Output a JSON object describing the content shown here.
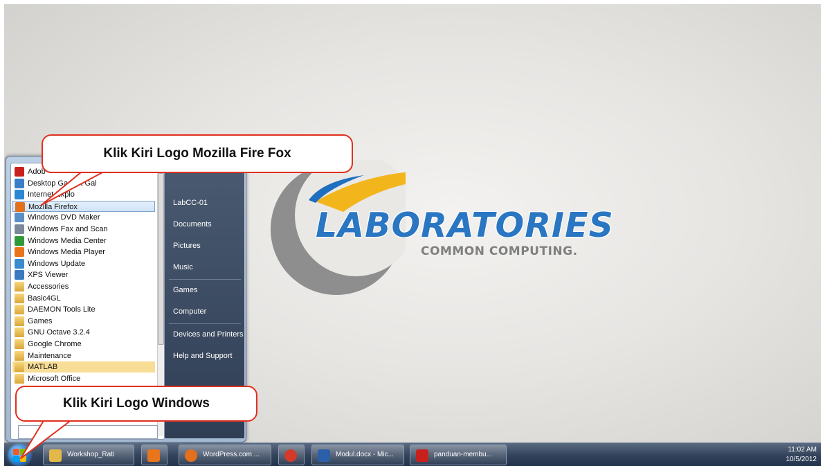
{
  "logo": {
    "brand": "LABORATORIES",
    "tagline": "COMMON COMPUTING."
  },
  "start_menu": {
    "programs": [
      {
        "label": "Adob",
        "icon": "adobe-reader-icon",
        "color": "#c8201c"
      },
      {
        "label": "Desktop Gadget Gal",
        "icon": "gadget-icon",
        "color": "#3b7ec8"
      },
      {
        "label": "Internet Explo",
        "icon": "internet-explorer-icon",
        "color": "#2b87d3"
      },
      {
        "label": "Mozilla Firefox",
        "icon": "firefox-icon",
        "color": "#e2701c"
      },
      {
        "label": "Windows DVD Maker",
        "icon": "dvd-maker-icon",
        "color": "#5a8fc8"
      },
      {
        "label": "Windows Fax and Scan",
        "icon": "fax-scan-icon",
        "color": "#7a8a9a"
      },
      {
        "label": "Windows Media Center",
        "icon": "media-center-icon",
        "color": "#2f9a3a"
      },
      {
        "label": "Windows Media Player",
        "icon": "media-player-icon",
        "color": "#e8741c"
      },
      {
        "label": "Windows Update",
        "icon": "windows-update-icon",
        "color": "#3a8ad0"
      },
      {
        "label": "XPS Viewer",
        "icon": "xps-viewer-icon",
        "color": "#3a7ac0"
      },
      {
        "label": "Accessories",
        "icon": "folder-icon",
        "color": "#e3b84a"
      },
      {
        "label": "Basic4GL",
        "icon": "folder-icon",
        "color": "#e3b84a"
      },
      {
        "label": "DAEMON Tools Lite",
        "icon": "folder-icon",
        "color": "#e3b84a"
      },
      {
        "label": "Games",
        "icon": "folder-icon",
        "color": "#e3b84a"
      },
      {
        "label": "GNU Octave 3.2.4",
        "icon": "folder-icon",
        "color": "#e3b84a"
      },
      {
        "label": "Google Chrome",
        "icon": "folder-icon",
        "color": "#e3b84a"
      },
      {
        "label": "Maintenance",
        "icon": "folder-icon",
        "color": "#e3b84a"
      },
      {
        "label": "MATLAB",
        "icon": "folder-icon",
        "color": "#e3b84a"
      },
      {
        "label": "Microsoft Office",
        "icon": "folder-icon",
        "color": "#e3b84a"
      }
    ],
    "places": [
      "LabCC-01",
      "Documents",
      "Pictures",
      "Music",
      "Games",
      "Computer",
      "Devices and Printers",
      "Help and Support"
    ]
  },
  "taskbar": {
    "buttons": [
      {
        "label": "Workshop_Rati",
        "icon": "folder-icon",
        "color": "#e3b84a"
      },
      {
        "label": "",
        "icon": "media-player-icon",
        "color": "#e8741c"
      },
      {
        "label": "WordPress.com ...",
        "icon": "firefox-icon",
        "color": "#e2701c"
      },
      {
        "label": "",
        "icon": "chrome-icon",
        "color": "#d43a2a"
      },
      {
        "label": "Modul.docx - Mic...",
        "icon": "word-icon",
        "color": "#2b5fa8"
      },
      {
        "label": "panduan-membu...",
        "icon": "pdf-icon",
        "color": "#c8201c"
      }
    ],
    "time": "11:02 AM",
    "date": "10/5/2012"
  },
  "callouts": {
    "firefox": "Klik Kiri Logo Mozilla Fire Fox",
    "windows": "Klik Kiri Logo Windows"
  },
  "colors": {
    "accent": "#e0301e",
    "brand_blue": "#2a76c2",
    "brand_yellow": "#f2b61c"
  }
}
